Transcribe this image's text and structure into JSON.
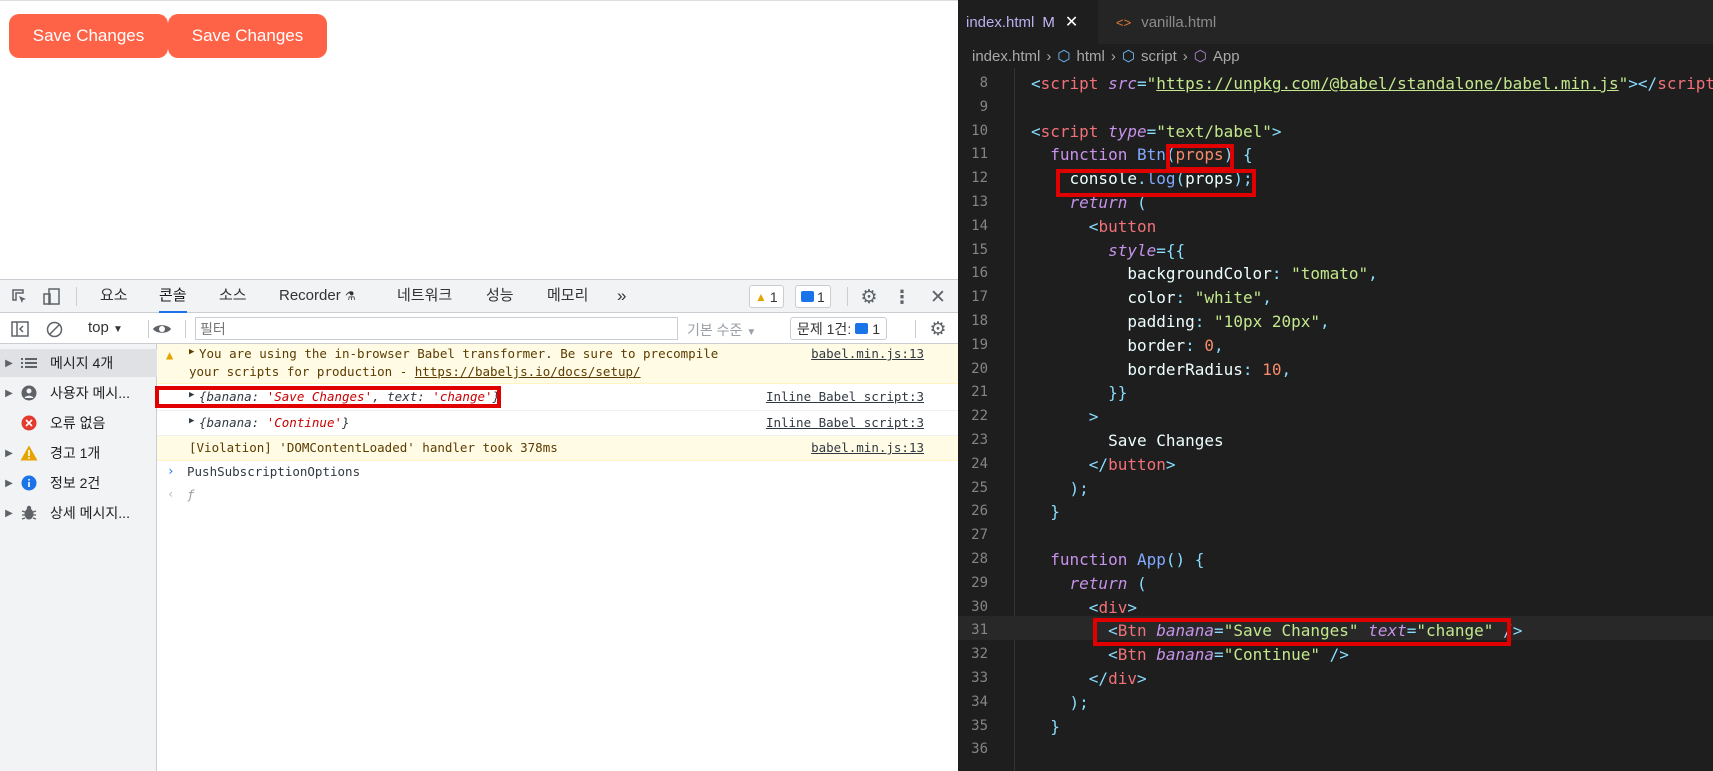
{
  "page": {
    "buttons": [
      "Save Changes",
      "Save Changes"
    ],
    "button_color": "#ff6347"
  },
  "devtools": {
    "tabs": [
      "요소",
      "콘솔",
      "소스",
      "Recorder",
      "네트워크",
      "성능",
      "메모리",
      "»"
    ],
    "active_tab": "콘솔",
    "warn_badge": "1",
    "info_badge": "1",
    "context": "top",
    "filter_placeholder": "필터",
    "levels": "기본 수준",
    "issues": "문제 1건:",
    "issues_count": "1",
    "sidebar": [
      {
        "label": "메시지 4개",
        "icon": "list-icon"
      },
      {
        "label": "사용자 메시...",
        "icon": "user-icon"
      },
      {
        "label": "오류 없음",
        "icon": "error-icon"
      },
      {
        "label": "경고 1개",
        "icon": "warning-icon"
      },
      {
        "label": "정보 2건",
        "icon": "info-icon"
      },
      {
        "label": "상세 메시지...",
        "icon": "bug-icon"
      }
    ],
    "console": {
      "warn1_line1": "You are using the in-browser Babel transformer. Be sure to precompile",
      "warn1_line2a": "your scripts for production - ",
      "warn1_link": "https://babeljs.io/docs/setup/",
      "warn1_src": "babel.min.js:13",
      "log1_prefix": "{banana: ",
      "log1_banana": "'Save Changes'",
      "log1_mid": ", text: ",
      "log1_text": "'change'",
      "log1_suffix": "}",
      "log1_src": "Inline Babel script:3",
      "log2_prefix": "{banana: ",
      "log2_banana": "'Continue'",
      "log2_suffix": "}",
      "log2_src": "Inline Babel script:3",
      "violation": "[Violation] 'DOMContentLoaded' handler took 378ms",
      "violation_src": "babel.min.js:13",
      "input_text": "PushSubscriptionOptions",
      "result": "ƒ"
    }
  },
  "editor": {
    "tabs": [
      {
        "label": "index.html",
        "flag": "M"
      },
      {
        "label": "vanilla.html"
      }
    ],
    "breadcrumb": [
      "index.html",
      "html",
      "script",
      "App"
    ],
    "lines": {
      "l8_src": "https://unpkg.com/@babel/standalone/babel.min.js",
      "l10_type": "\"text/babel\"",
      "l11_fn": "Btn",
      "l11_param": "props",
      "l12": "console",
      "l12_log": "log",
      "l12_arg": "props",
      "l16": "backgroundColor",
      "l16_v": "\"tomato\"",
      "l17": "color",
      "l17_v": "\"white\"",
      "l18": "padding",
      "l18_v": "\"10px 20px\"",
      "l19": "border",
      "l19_v": "0",
      "l20": "borderRadius",
      "l20_v": "10",
      "l23": "Save Changes",
      "l28_fn": "App",
      "l31_banana": "\"Save Changes\"",
      "l31_text": "\"change\"",
      "l32_banana": "\"Continue\""
    },
    "line_numbers": [
      "8",
      "9",
      "10",
      "11",
      "12",
      "13",
      "14",
      "15",
      "16",
      "17",
      "18",
      "19",
      "20",
      "21",
      "22",
      "23",
      "24",
      "25",
      "26",
      "27",
      "28",
      "29",
      "30",
      "31",
      "32",
      "33",
      "34",
      "35",
      "36"
    ]
  }
}
